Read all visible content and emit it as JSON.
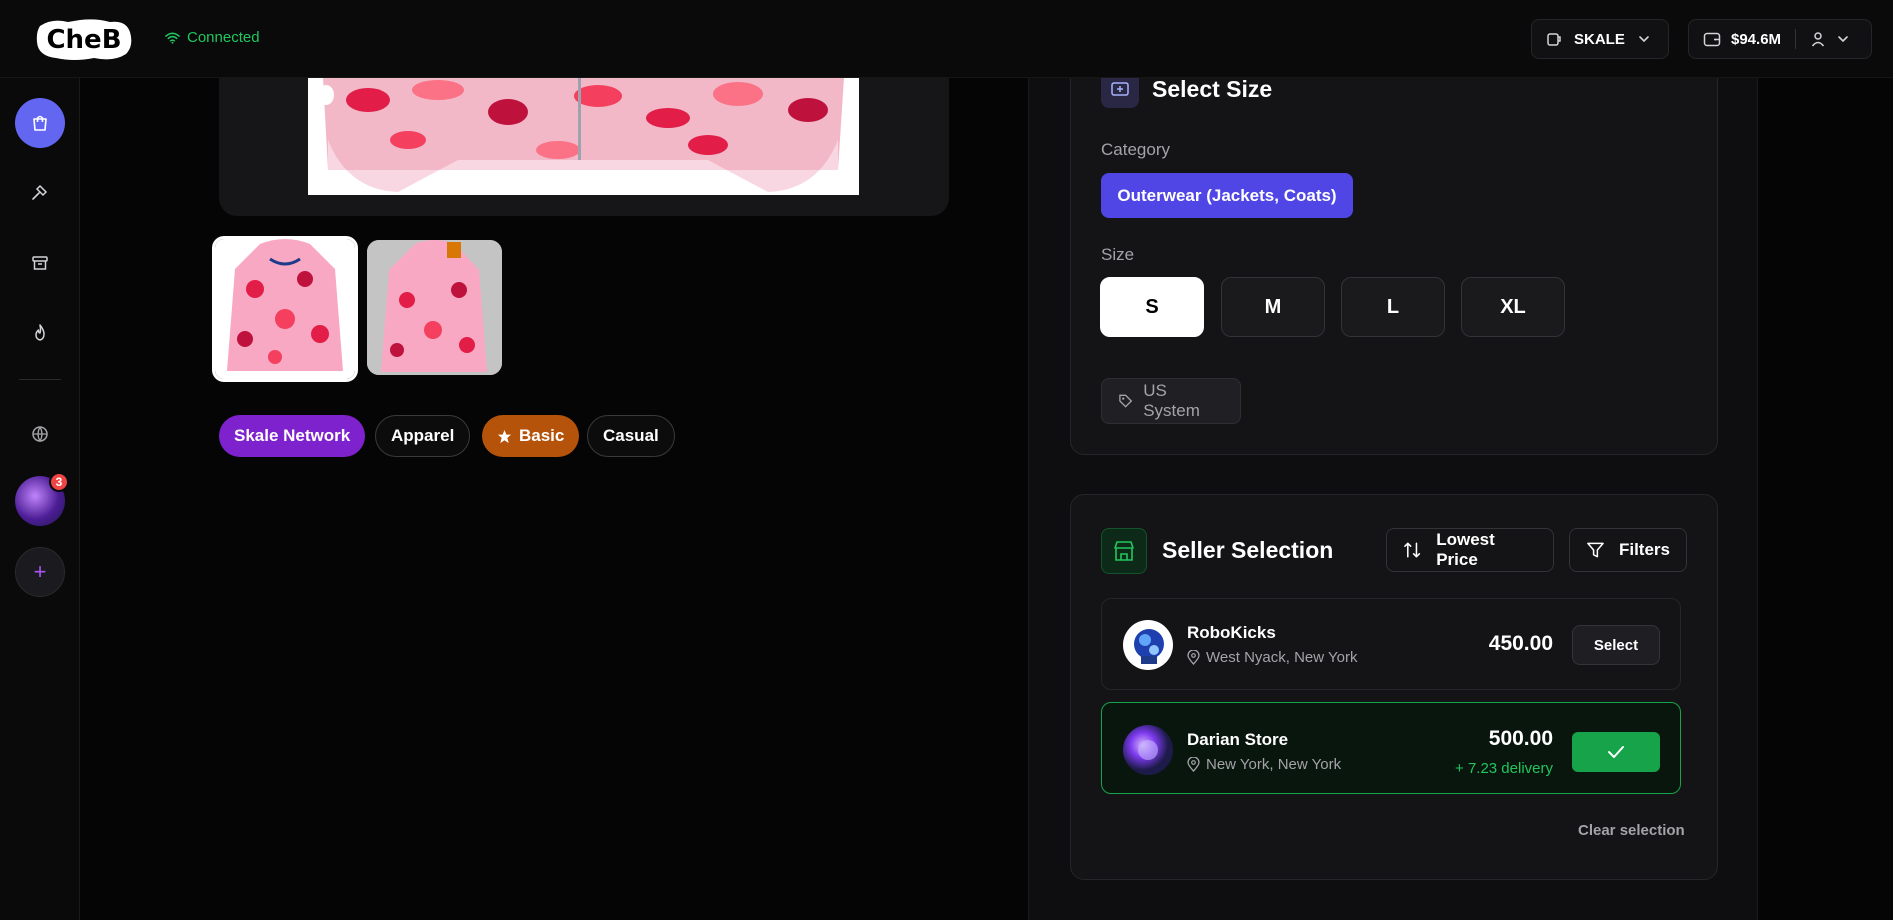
{
  "header": {
    "logo_text": "CheB",
    "connection_status": "Connected",
    "network_label": "SKALE",
    "balance": "$94.6M"
  },
  "sidebar": {
    "items": [
      {
        "icon": "shopping-bag-icon",
        "active": true
      },
      {
        "icon": "hammer-icon"
      },
      {
        "icon": "archive-icon"
      },
      {
        "icon": "flame-icon"
      },
      {
        "icon": "globe-icon"
      }
    ],
    "notification_count": "3",
    "add_label": "+"
  },
  "product": {
    "tags": [
      {
        "label": "Skale Network",
        "color": "#7e22ce"
      },
      {
        "label": "Apparel"
      },
      {
        "label": "Basic",
        "color": "#b45309",
        "icon": "star-icon"
      },
      {
        "label": "Casual"
      }
    ]
  },
  "size_panel": {
    "title": "Select Size",
    "category_label": "Category",
    "category_value": "Outerwear (Jackets, Coats)",
    "size_label": "Size",
    "sizes": [
      "S",
      "M",
      "L",
      "XL"
    ],
    "selected_size": "S",
    "system_label": "US System"
  },
  "seller_panel": {
    "title": "Seller Selection",
    "sort_label": "Lowest Price",
    "filters_label": "Filters",
    "sellers": [
      {
        "name": "RoboKicks",
        "location": "West Nyack, New York",
        "price": "450.00",
        "action": "Select"
      },
      {
        "name": "Darian Store",
        "location": "New York, New York",
        "price": "500.00",
        "delivery": "+ 7.23 delivery",
        "selected": true
      }
    ],
    "clear_label": "Clear selection"
  },
  "colors": {
    "accent": "#6366f1",
    "success": "#16a34a",
    "brand_purple": "#7e22ce"
  }
}
